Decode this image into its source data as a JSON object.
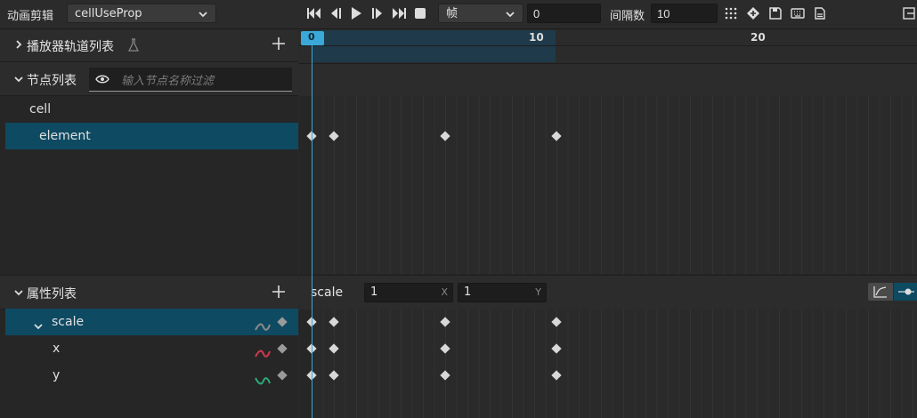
{
  "toolbar": {
    "clip_label": "动画剪辑",
    "clip_value": "cellUseProp",
    "unit_value": "帧",
    "frame_value": "0",
    "interval_label": "间隔数",
    "interval_value": "10"
  },
  "ruler": {
    "ticks": [
      "0",
      "10",
      "20"
    ]
  },
  "player_tracks": {
    "title": "播放器轨道列表"
  },
  "node_list": {
    "title": "节点列表",
    "filter_placeholder": "输入节点名称过滤",
    "items": [
      "cell",
      "element"
    ]
  },
  "property_list": {
    "title": "属性列表",
    "items": [
      "scale",
      "x",
      "y"
    ]
  },
  "prop_editor": {
    "name": "scale",
    "x_value": "1",
    "x_axis": "X",
    "y_value": "1",
    "y_axis": "Y"
  },
  "keyframes": {
    "frames": [
      0,
      1,
      6,
      11
    ]
  },
  "colors": {
    "accent": "#3aa8d8",
    "selected_row": "#0e4a62",
    "x_curve": "#d0394d",
    "y_curve": "#2fa87a",
    "scale_curve": "#8a8a8a"
  }
}
